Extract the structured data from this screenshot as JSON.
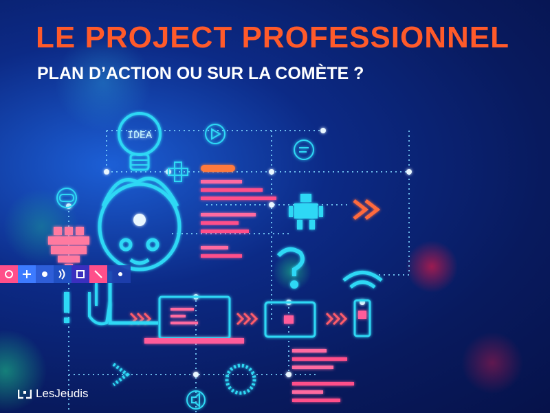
{
  "header": {
    "title": "LE PROJECT PROFESSIONNEL",
    "subtitle": "PLAN D’ACTION OU SUR LA COMÈTE ?"
  },
  "illustration": {
    "idea_bulb_text": "IDEA",
    "colors": {
      "title": "#ff5a2a",
      "neon_cyan": "#2fd8f5",
      "neon_pink": "#ff4f8a",
      "neon_orange": "#ff7a3c",
      "node_white": "#e8f6ff"
    }
  },
  "footer": {
    "brand_name": "LesJeudis"
  }
}
